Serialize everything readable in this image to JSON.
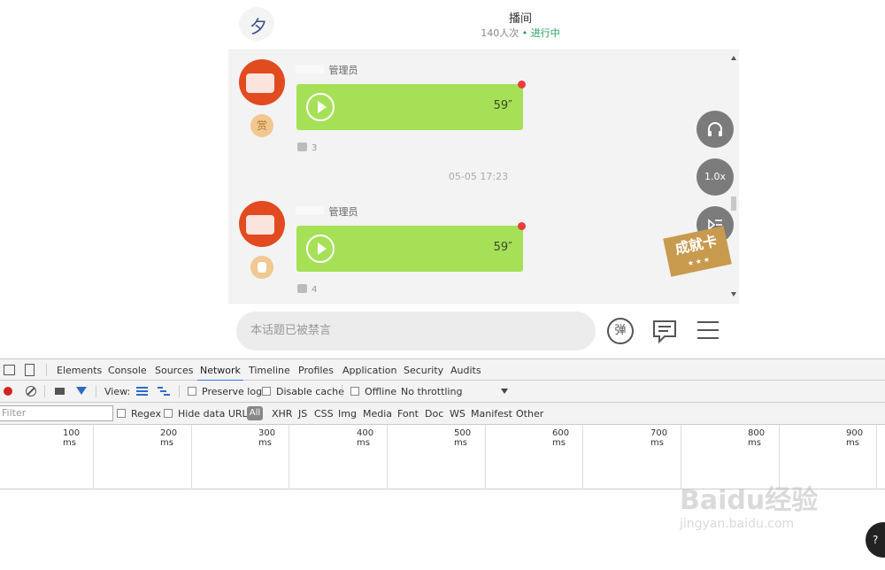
{
  "room": {
    "logo_icon": "brand-logo-icon",
    "title": "播间",
    "viewers": "140人次",
    "status": "进行中"
  },
  "messages": [
    {
      "role": "管理员",
      "reward": "赏",
      "duration": "59″",
      "likes": "3"
    },
    {
      "role": "管理员",
      "reward": "",
      "duration": "59″",
      "likes": "4"
    }
  ],
  "timestamp": "05-05 17:23",
  "floating": {
    "headphones_icon": "headphones-icon",
    "speed": "1.0x",
    "playlist_icon": "playlist-icon",
    "achievement_card": "成就卡"
  },
  "input_bar": {
    "placeholder": "本话题已被禁言",
    "danmu": "弹",
    "comment_icon": "comment-icon",
    "menu_icon": "menu-icon"
  },
  "devtools": {
    "tabs": [
      "Elements",
      "Console",
      "Sources",
      "Network",
      "Timeline",
      "Profiles",
      "Application",
      "Security",
      "Audits"
    ],
    "active_tab": "Network",
    "toolbar": {
      "view_label": "View:",
      "preserve_log": "Preserve log",
      "disable_cache": "Disable cache",
      "offline": "Offline",
      "throttling": "No throttling"
    },
    "filter": {
      "placeholder": "Filter",
      "regex": "Regex",
      "hide_data_urls": "Hide data URLs",
      "types": [
        "All",
        "XHR",
        "JS",
        "CSS",
        "Img",
        "Media",
        "Font",
        "Doc",
        "WS",
        "Manifest",
        "Other"
      ]
    },
    "timeline_labels": [
      "100 ms",
      "200 ms",
      "300 ms",
      "400 ms",
      "500 ms",
      "600 ms",
      "700 ms",
      "800 ms",
      "900 ms"
    ]
  },
  "watermark": {
    "logo": "Baidu经验",
    "url": "jingyan.baidu.com"
  },
  "colors": {
    "voice_bubble": "#a6e057",
    "live_status": "#22a15a",
    "active_tab_underline": "#3879d9",
    "record_dot": "#d42222"
  }
}
